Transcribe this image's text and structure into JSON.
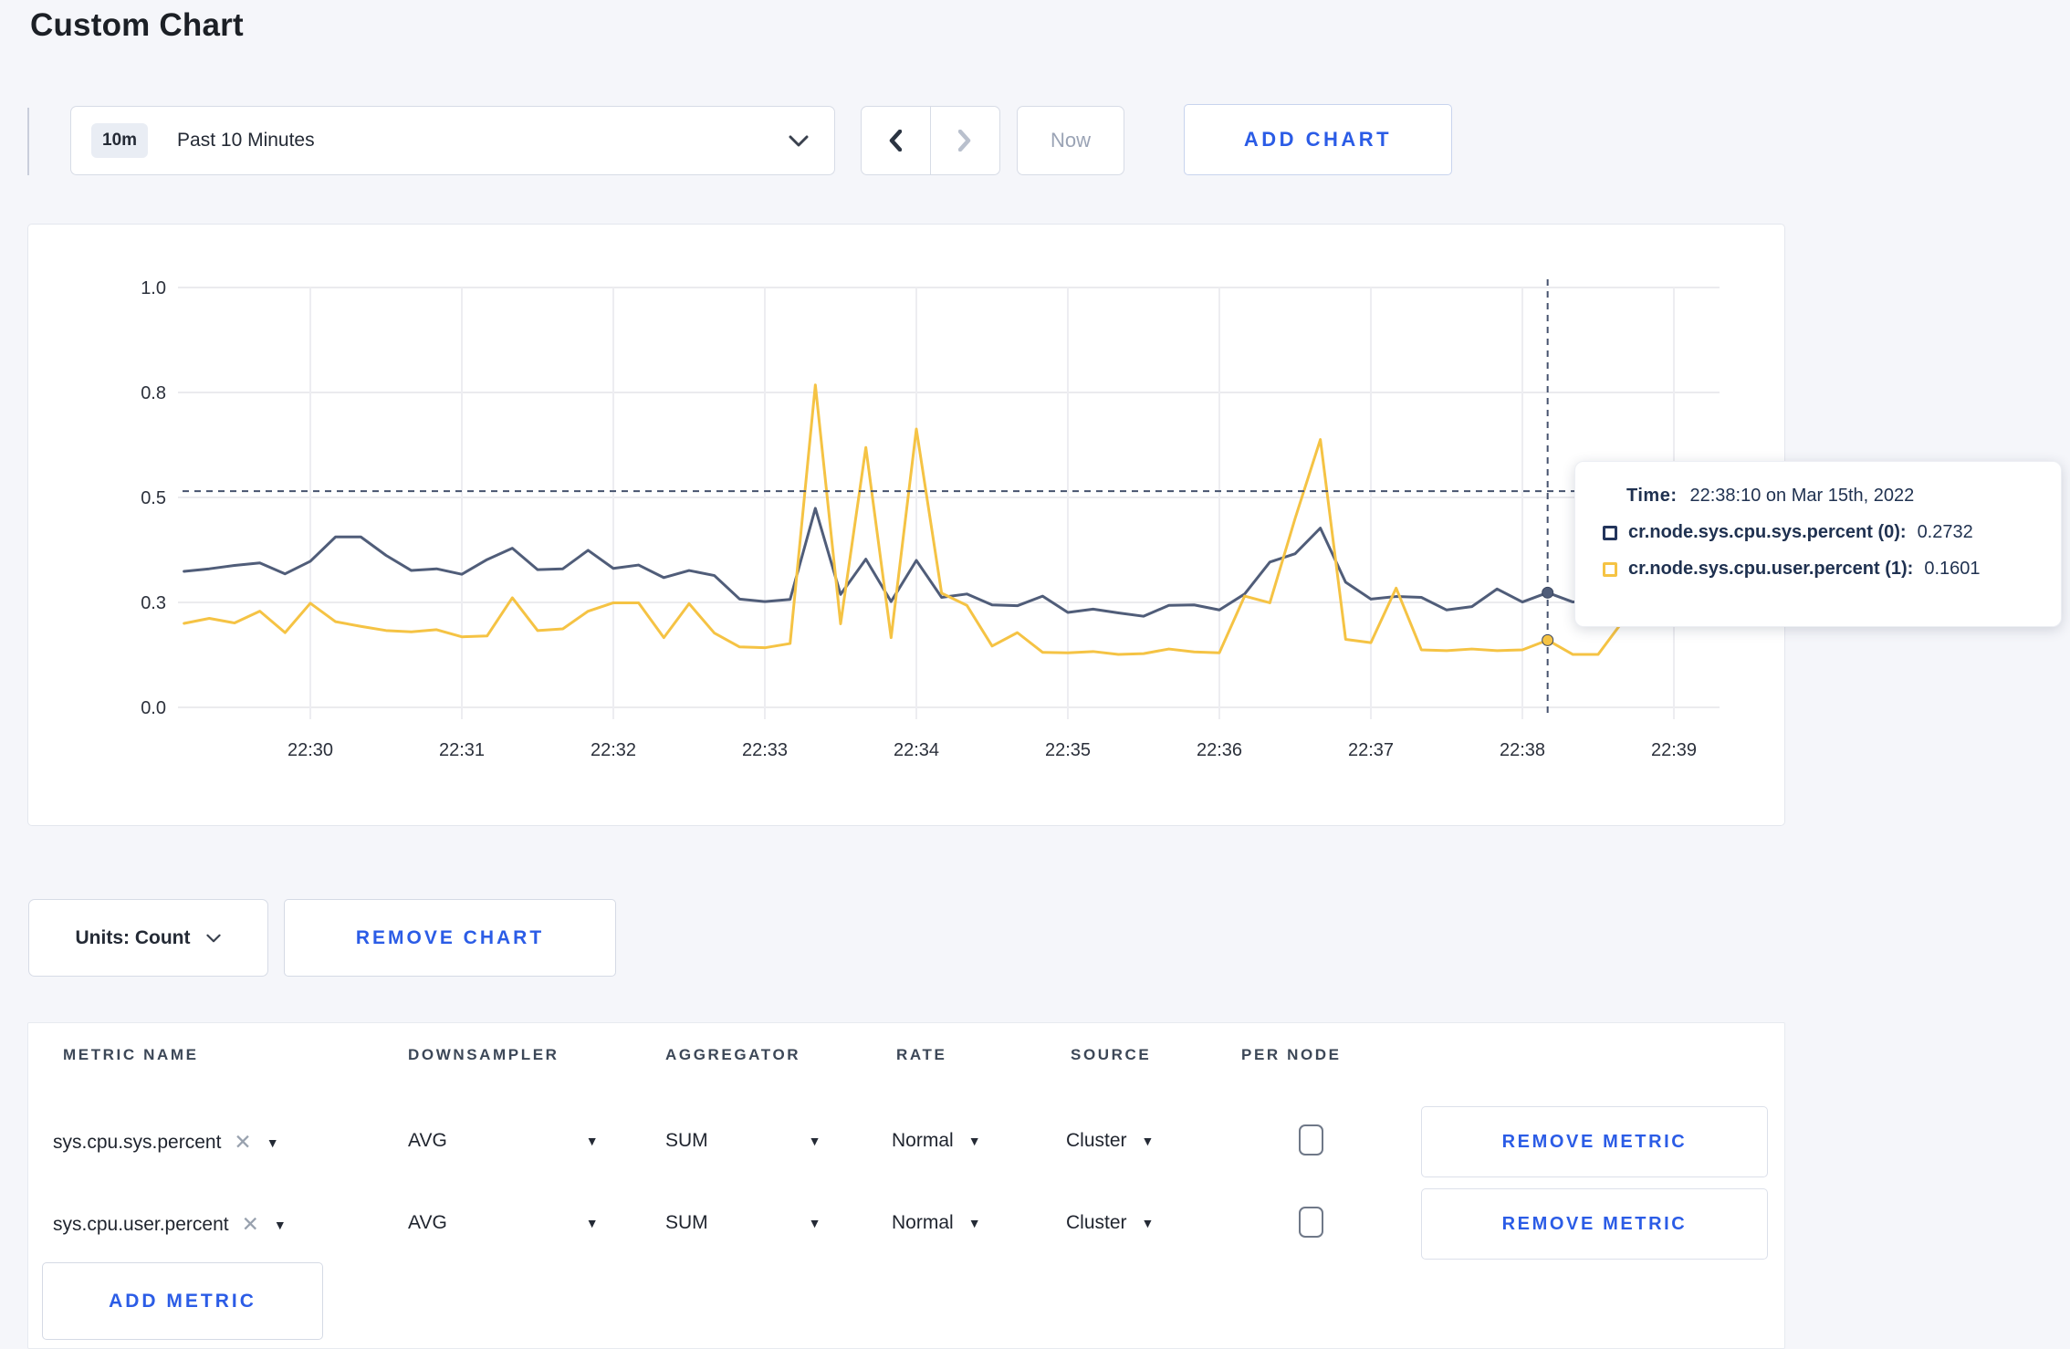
{
  "page": {
    "title": "Custom Chart"
  },
  "controls": {
    "time_window_badge": "10m",
    "time_window_label": "Past 10 Minutes",
    "now_label": "Now",
    "add_chart_label": "ADD CHART"
  },
  "chart": {
    "units_label": "Units: Count",
    "remove_chart_label": "REMOVE CHART",
    "tooltip": {
      "time_label": "Time:",
      "time_value": "22:38:10 on Mar 15th, 2022",
      "series": [
        {
          "label": "cr.node.sys.cpu.sys.percent (0):",
          "value": "0.2732"
        },
        {
          "label": "cr.node.sys.cpu.user.percent (1):",
          "value": "0.1601"
        }
      ]
    }
  },
  "chart_data": {
    "type": "line",
    "title": "",
    "xlabel": "",
    "ylabel": "",
    "ylim": [
      0,
      1
    ],
    "grid": true,
    "x_ticks": [
      {
        "label": "22:30",
        "seconds": 0
      },
      {
        "label": "22:31",
        "seconds": 60
      },
      {
        "label": "22:32",
        "seconds": 120
      },
      {
        "label": "22:33",
        "seconds": 180
      },
      {
        "label": "22:34",
        "seconds": 240
      },
      {
        "label": "22:35",
        "seconds": 300
      },
      {
        "label": "22:36",
        "seconds": 360
      },
      {
        "label": "22:37",
        "seconds": 420
      },
      {
        "label": "22:38",
        "seconds": 480
      },
      {
        "label": "22:39",
        "seconds": 540
      }
    ],
    "y_ticks": [
      {
        "label": "0.0",
        "value": 0
      },
      {
        "label": "0.3",
        "value": 0.25
      },
      {
        "label": "0.5",
        "value": 0.5
      },
      {
        "label": "0.8",
        "value": 0.75
      },
      {
        "label": "1.0",
        "value": 1
      }
    ],
    "hover": {
      "time": "22:38:10",
      "x_seconds": 490,
      "crosshair_value": 0.515,
      "values": [
        0.2732,
        0.1601
      ]
    },
    "series": [
      {
        "name": "cr.node.sys.cpu.sys.percent",
        "color": "#505d79",
        "points": [
          [
            -50,
            0.324
          ],
          [
            -40,
            0.33
          ],
          [
            -30,
            0.338
          ],
          [
            -20,
            0.344
          ],
          [
            -10,
            0.318
          ],
          [
            0,
            0.348
          ],
          [
            10,
            0.406
          ],
          [
            20,
            0.406
          ],
          [
            30,
            0.362
          ],
          [
            40,
            0.326
          ],
          [
            50,
            0.33
          ],
          [
            60,
            0.317
          ],
          [
            70,
            0.352
          ],
          [
            80,
            0.379
          ],
          [
            90,
            0.328
          ],
          [
            100,
            0.33
          ],
          [
            110,
            0.374
          ],
          [
            120,
            0.331
          ],
          [
            130,
            0.339
          ],
          [
            140,
            0.309
          ],
          [
            150,
            0.326
          ],
          [
            160,
            0.314
          ],
          [
            170,
            0.258
          ],
          [
            180,
            0.252
          ],
          [
            190,
            0.257
          ],
          [
            200,
            0.474
          ],
          [
            210,
            0.269
          ],
          [
            220,
            0.353
          ],
          [
            230,
            0.252
          ],
          [
            240,
            0.35
          ],
          [
            250,
            0.262
          ],
          [
            260,
            0.27
          ],
          [
            270,
            0.244
          ],
          [
            280,
            0.242
          ],
          [
            290,
            0.265
          ],
          [
            300,
            0.226
          ],
          [
            310,
            0.234
          ],
          [
            320,
            0.225
          ],
          [
            330,
            0.217
          ],
          [
            340,
            0.243
          ],
          [
            350,
            0.244
          ],
          [
            360,
            0.232
          ],
          [
            370,
            0.27
          ],
          [
            380,
            0.346
          ],
          [
            390,
            0.366
          ],
          [
            400,
            0.427
          ],
          [
            410,
            0.298
          ],
          [
            420,
            0.258
          ],
          [
            430,
            0.264
          ],
          [
            440,
            0.262
          ],
          [
            450,
            0.232
          ],
          [
            460,
            0.24
          ],
          [
            470,
            0.282
          ],
          [
            480,
            0.251
          ],
          [
            490,
            0.2732
          ],
          [
            500,
            0.251
          ],
          [
            510,
            0.255
          ],
          [
            520,
            0.272
          ],
          [
            530,
            0.295
          ],
          [
            540,
            0.31
          ],
          [
            550,
            0.3
          ],
          [
            560,
            0.3
          ]
        ]
      },
      {
        "name": "cr.node.sys.cpu.user.percent",
        "color": "#f5c344",
        "points": [
          [
            -50,
            0.2
          ],
          [
            -40,
            0.212
          ],
          [
            -30,
            0.201
          ],
          [
            -20,
            0.229
          ],
          [
            -10,
            0.178
          ],
          [
            0,
            0.248
          ],
          [
            10,
            0.204
          ],
          [
            20,
            0.193
          ],
          [
            30,
            0.183
          ],
          [
            40,
            0.18
          ],
          [
            50,
            0.185
          ],
          [
            60,
            0.168
          ],
          [
            70,
            0.17
          ],
          [
            80,
            0.261
          ],
          [
            90,
            0.183
          ],
          [
            100,
            0.187
          ],
          [
            110,
            0.229
          ],
          [
            120,
            0.249
          ],
          [
            130,
            0.249
          ],
          [
            140,
            0.166
          ],
          [
            150,
            0.247
          ],
          [
            160,
            0.177
          ],
          [
            170,
            0.144
          ],
          [
            180,
            0.142
          ],
          [
            190,
            0.152
          ],
          [
            200,
            0.768
          ],
          [
            210,
            0.199
          ],
          [
            220,
            0.619
          ],
          [
            230,
            0.166
          ],
          [
            240,
            0.663
          ],
          [
            250,
            0.272
          ],
          [
            260,
            0.243
          ],
          [
            270,
            0.146
          ],
          [
            280,
            0.178
          ],
          [
            290,
            0.131
          ],
          [
            300,
            0.13
          ],
          [
            310,
            0.133
          ],
          [
            320,
            0.126
          ],
          [
            330,
            0.128
          ],
          [
            340,
            0.139
          ],
          [
            350,
            0.132
          ],
          [
            360,
            0.13
          ],
          [
            370,
            0.265
          ],
          [
            380,
            0.249
          ],
          [
            390,
            0.45
          ],
          [
            400,
            0.638
          ],
          [
            410,
            0.162
          ],
          [
            420,
            0.154
          ],
          [
            430,
            0.284
          ],
          [
            440,
            0.137
          ],
          [
            450,
            0.135
          ],
          [
            460,
            0.139
          ],
          [
            470,
            0.135
          ],
          [
            480,
            0.137
          ],
          [
            490,
            0.1601
          ],
          [
            500,
            0.126
          ],
          [
            510,
            0.126
          ],
          [
            520,
            0.207
          ],
          [
            530,
            0.232
          ],
          [
            540,
            0.195
          ],
          [
            550,
            0.247
          ],
          [
            560,
            0.225
          ]
        ]
      }
    ]
  },
  "table": {
    "headers": {
      "metric_name": "METRIC NAME",
      "downsampler": "DOWNSAMPLER",
      "aggregator": "AGGREGATOR",
      "rate": "RATE",
      "source": "SOURCE",
      "per_node": "PER NODE"
    },
    "rows": [
      {
        "metric": "sys.cpu.sys.percent",
        "downsampler": "AVG",
        "aggregator": "SUM",
        "rate": "Normal",
        "source": "Cluster",
        "per_node_checked": false,
        "remove_label": "REMOVE METRIC"
      },
      {
        "metric": "sys.cpu.user.percent",
        "downsampler": "AVG",
        "aggregator": "SUM",
        "rate": "Normal",
        "source": "Cluster",
        "per_node_checked": false,
        "remove_label": "REMOVE METRIC"
      }
    ],
    "add_metric_label": "ADD METRIC"
  }
}
